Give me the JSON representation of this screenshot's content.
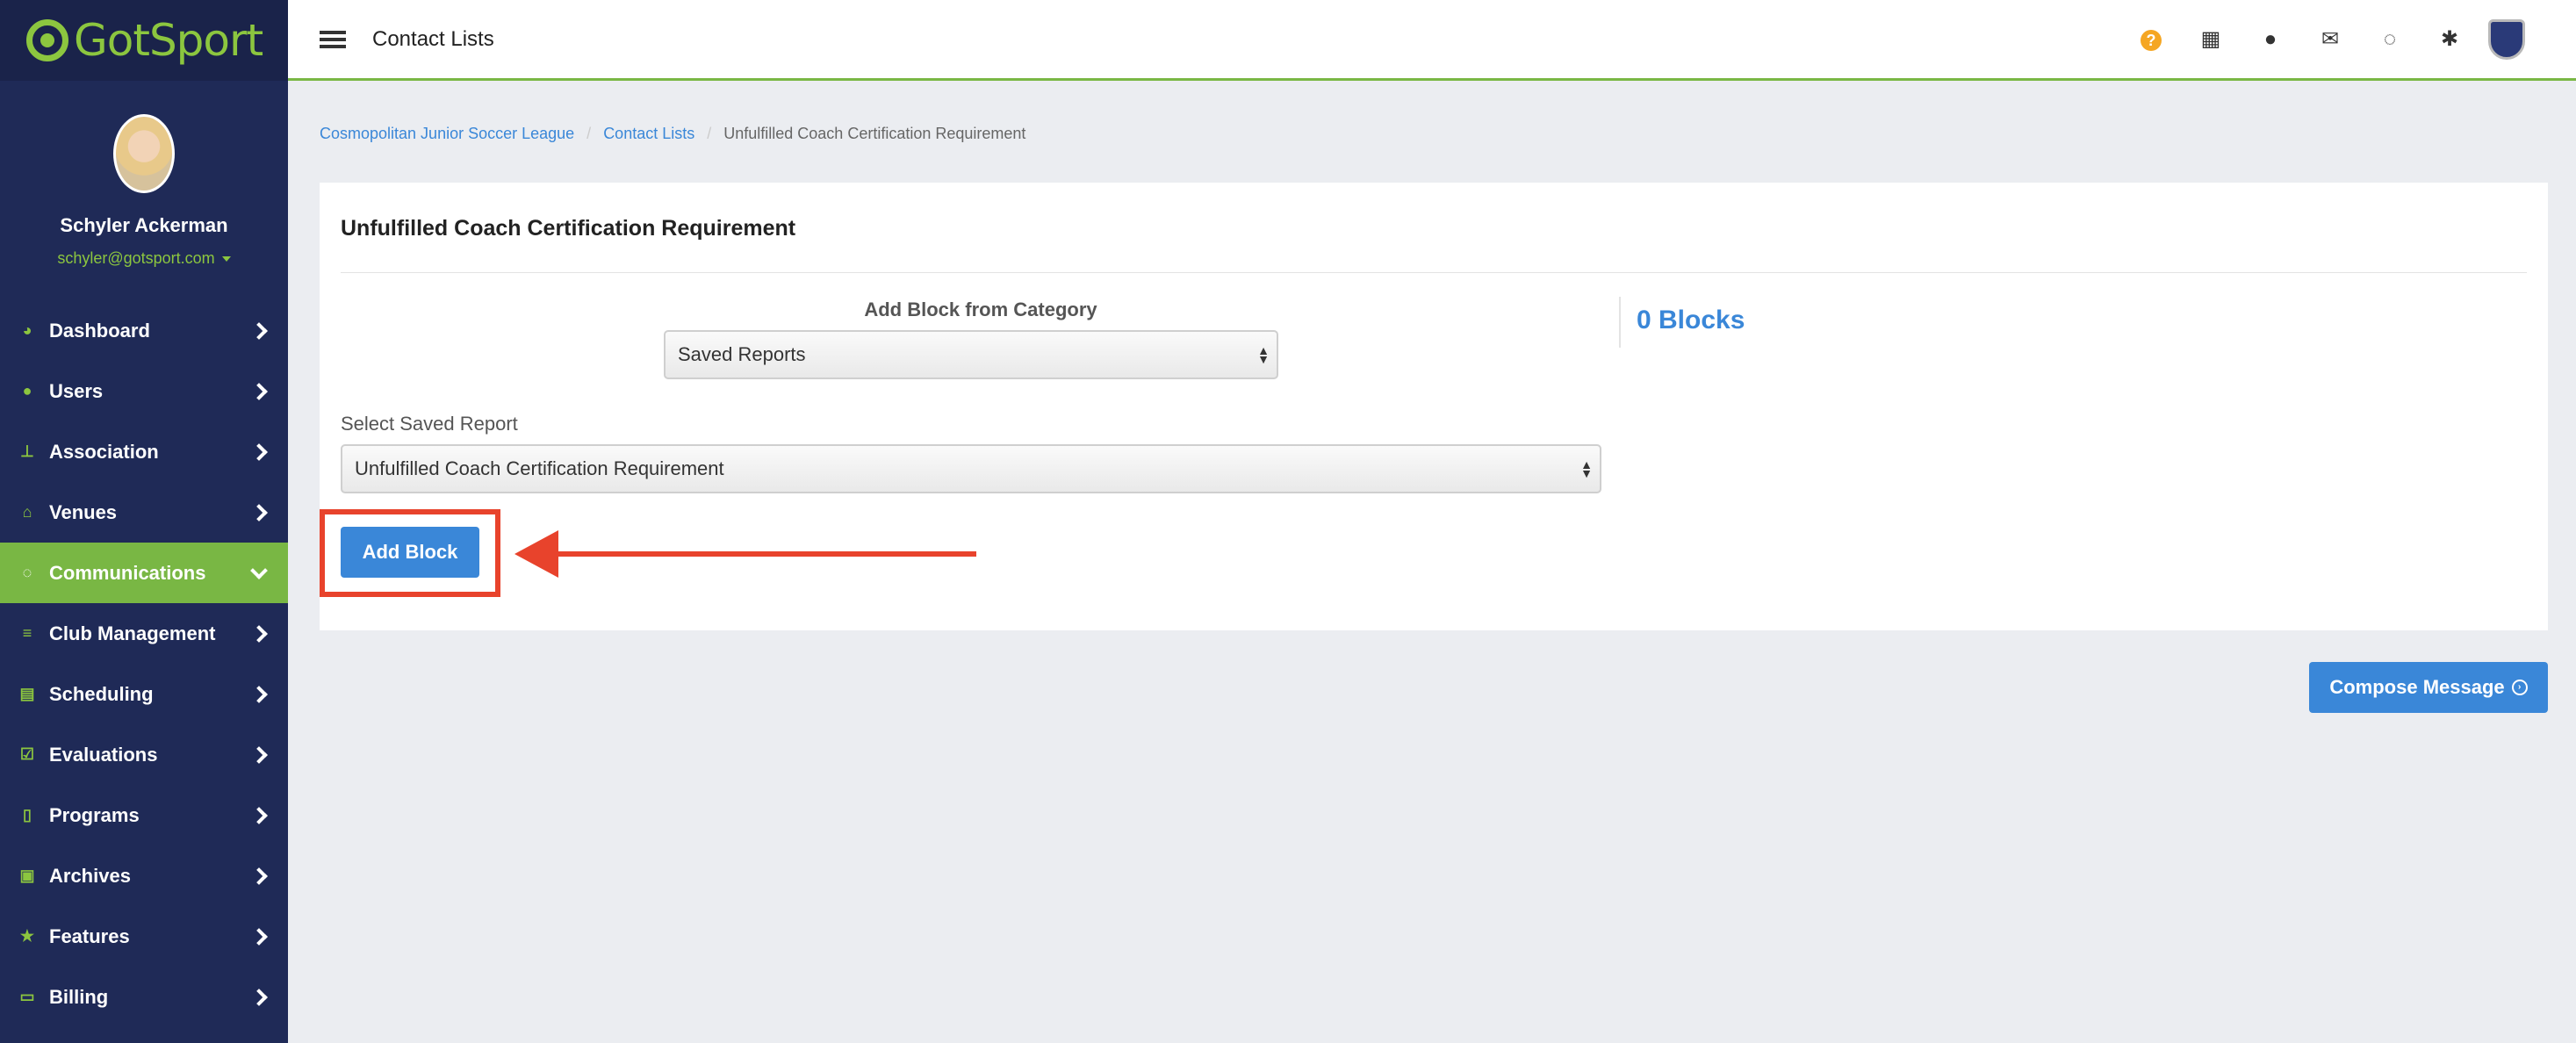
{
  "brand": {
    "name": "GotSport",
    "accent": "#8cc63f",
    "primary": "#3a87d8"
  },
  "user": {
    "name": "Schyler Ackerman",
    "email": "schyler@gotsport.com"
  },
  "nav": [
    {
      "label": "Dashboard",
      "icon": "dashboard-icon",
      "active": false
    },
    {
      "label": "Users",
      "icon": "users-icon",
      "active": false
    },
    {
      "label": "Association",
      "icon": "sitemap-icon",
      "active": false
    },
    {
      "label": "Venues",
      "icon": "home-icon",
      "active": false
    },
    {
      "label": "Communications",
      "icon": "chat-icon",
      "active": true
    },
    {
      "label": "Club Management",
      "icon": "list-icon",
      "active": false
    },
    {
      "label": "Scheduling",
      "icon": "calendar-icon",
      "active": false
    },
    {
      "label": "Evaluations",
      "icon": "checklist-icon",
      "active": false
    },
    {
      "label": "Programs",
      "icon": "document-icon",
      "active": false
    },
    {
      "label": "Archives",
      "icon": "archive-icon",
      "active": false
    },
    {
      "label": "Features",
      "icon": "star-icon",
      "active": false
    },
    {
      "label": "Billing",
      "icon": "credit-card-icon",
      "active": false
    }
  ],
  "header": {
    "title": "Contact Lists"
  },
  "breadcrumb": {
    "league": "Cosmopolitan Junior Soccer League",
    "contact_lists": "Contact Lists",
    "current": "Unfulfilled Coach Certification Requirement"
  },
  "panel": {
    "title": "Unfulfilled Coach Certification Requirement",
    "category_label": "Add Block from Category",
    "category_value": "Saved Reports",
    "report_label": "Select Saved Report",
    "report_value": "Unfulfilled Coach Certification Requirement",
    "blocks_count": "0 Blocks",
    "add_block_label": "Add Block"
  },
  "compose": {
    "label": "Compose Message"
  }
}
